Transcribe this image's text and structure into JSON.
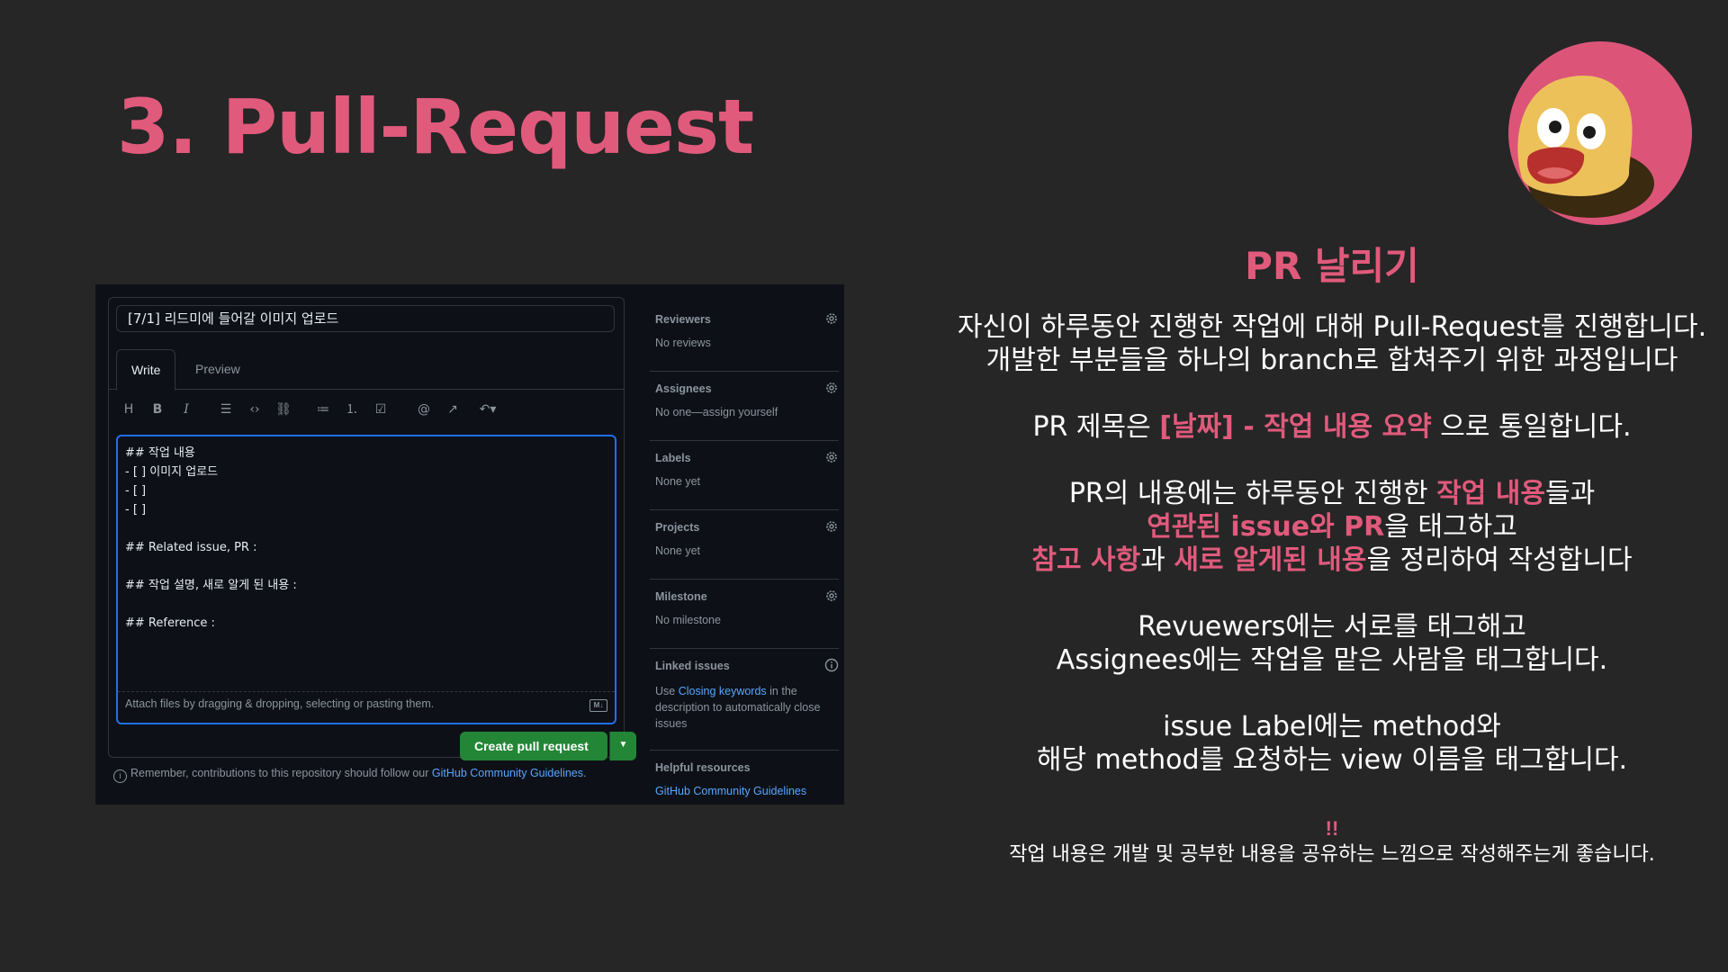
{
  "slide": {
    "title": "3. Pull-Request"
  },
  "pr_form": {
    "title_value": "[7/1] 리드미에 들어갈 이미지 업로드",
    "tabs": [
      "Write",
      "Preview"
    ],
    "toolbar_icons": [
      "heading-icon",
      "bold-icon",
      "italic-icon",
      "quote-icon",
      "code-icon",
      "link-icon",
      "bulleted-list-icon",
      "numbered-list-icon",
      "task-list-icon",
      "mention-icon",
      "cross-reference-icon",
      "undo-icon"
    ],
    "body_text": "## 작업 내용\n- [ ] 이미지 업로드\n- [ ]\n- [ ]\n\n## Related issue, PR :\n\n## 작업 설명, 새로 알게 된 내용 :\n\n## Reference :",
    "attach_hint": "Attach files by dragging & dropping, selecting or pasting them.",
    "create_button": "Create pull request",
    "remember_prefix": "Remember, contributions to this repository should follow our ",
    "remember_link": "GitHub Community Guidelines",
    "remember_suffix": "."
  },
  "sidebar": {
    "reviewers": {
      "label": "Reviewers",
      "value": "No reviews"
    },
    "assignees": {
      "label": "Assignees",
      "value": "No one—assign yourself"
    },
    "labels": {
      "label": "Labels",
      "value": "None yet"
    },
    "projects": {
      "label": "Projects",
      "value": "None yet"
    },
    "milestone": {
      "label": "Milestone",
      "value": "No milestone"
    },
    "linked_issues": {
      "label": "Linked issues",
      "desc_prefix": "Use ",
      "desc_link": "Closing keywords",
      "desc_suffix": " in the description to automatically close issues"
    },
    "helpful": {
      "label": "Helpful resources",
      "link": "GitHub Community Guidelines"
    }
  },
  "explain": {
    "heading": "PR 날리기",
    "p1_line1": "자신이 하루동안 진행한 작업에 대해 Pull-Request를 진행합니다.",
    "p1_line2": "개발한 부분들을 하나의 branch로 합쳐주기 위한 과정입니다",
    "p2_pre": "PR 제목은 ",
    "p2_hl": "[날짜] - 작업 내용 요약",
    "p2_post": " 으로 통일합니다.",
    "p3_a": "PR의 내용에는 하루동안 진행한 ",
    "p3_hl1": "작업 내용",
    "p3_b": "들과",
    "p3_hl2": "연관된 issue와 PR",
    "p3_c": "을 태그하고",
    "p3_hl3": "참고 사항",
    "p3_d": "과 ",
    "p3_hl4": "새로 알게된 내용",
    "p3_e": "을 정리하여 작성합니다",
    "p4_line1": "Revuewers에는 서로를 태그해고",
    "p4_line2": "Assignees에는 작업을 맡은 사람을 태그합니다.",
    "p5_line1": "issue Label에는 method와",
    "p5_line2": "해당 method를 요청하는 view 이름을 태그합니다.",
    "warn": "!!",
    "note": "작업 내용은 개발 및 공부한 내용을 공유하는 느낌으로 작성해주는게 좋습니다."
  },
  "colors": {
    "accent": "#e05a7c",
    "background": "#262626",
    "github_bg": "#0d1117",
    "github_green": "#238636",
    "github_link": "#58a6ff"
  }
}
